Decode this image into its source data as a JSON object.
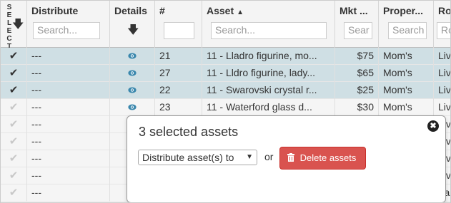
{
  "header": {
    "select_letters": [
      "S",
      "E",
      "L",
      "E",
      "C",
      "T"
    ],
    "columns": [
      {
        "label": "Distribute",
        "placeholder": "Search..."
      },
      {
        "label": "Details"
      },
      {
        "label": "#",
        "placeholder": ""
      },
      {
        "label": "Asset",
        "placeholder": "Search..."
      },
      {
        "label": "Mkt ...",
        "placeholder": "Sear"
      },
      {
        "label": "Proper...",
        "placeholder": "Search"
      },
      {
        "label": "Ro",
        "placeholder": "Ro"
      }
    ]
  },
  "rows": [
    {
      "selected": true,
      "distribute": "---",
      "num": "21",
      "asset": "11 - Lladro figurine, mo...",
      "mkt": "$75",
      "property": "Mom's",
      "room": "Liv"
    },
    {
      "selected": true,
      "distribute": "---",
      "num": "27",
      "asset": "11 - Lldro figurine, lady...",
      "mkt": "$65",
      "property": "Mom's",
      "room": "Liv"
    },
    {
      "selected": true,
      "distribute": "---",
      "num": "22",
      "asset": "11 - Swarovski crystal r...",
      "mkt": "$25",
      "property": "Mom's",
      "room": "Liv"
    },
    {
      "selected": false,
      "distribute": "---",
      "num": "23",
      "asset": "11 - Waterford glass d...",
      "mkt": "$30",
      "property": "Mom's",
      "room": "Liv"
    },
    {
      "selected": false,
      "distribute": "---",
      "num": "",
      "asset": "",
      "mkt": "",
      "property": "",
      "room": "Liv"
    },
    {
      "selected": false,
      "distribute": "---",
      "num": "",
      "asset": "",
      "mkt": "",
      "property": "",
      "room": "Liv"
    },
    {
      "selected": false,
      "distribute": "---",
      "num": "",
      "asset": "",
      "mkt": "",
      "property": "",
      "room": "Liv"
    },
    {
      "selected": false,
      "distribute": "---",
      "num": "",
      "asset": "",
      "mkt": "",
      "property": "",
      "room": "Liv"
    },
    {
      "selected": false,
      "distribute": "---",
      "num": "",
      "asset": "",
      "mkt": "",
      "property": "",
      "room": "Fa"
    }
  ],
  "popup": {
    "title": "3 selected assets",
    "distribute_select": "Distribute asset(s) to",
    "or_text": "or",
    "delete_label": "Delete assets"
  },
  "icons": {
    "check": "check-icon",
    "eye": "eye-icon",
    "trash": "trash-icon",
    "close": "close-circle-icon"
  },
  "colors": {
    "selected_row": "#cfdfe4",
    "delete_button": "#d9534f",
    "eye_icon": "#3a87ad"
  }
}
